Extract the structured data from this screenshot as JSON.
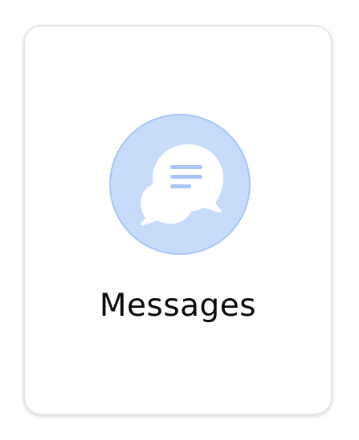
{
  "tile": {
    "label": "Messages",
    "icon": "chat-bubbles-icon",
    "colors": {
      "icon_background": "#c7dcfa",
      "icon_border": "#a8c7f6",
      "bubble_fill": "#ffffff",
      "bubble_lines": "#a8c7f6",
      "label_text": "#0a0a0a",
      "card_border": "#e5e5e5"
    }
  }
}
